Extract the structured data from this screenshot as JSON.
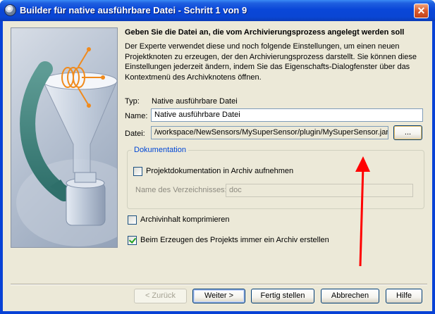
{
  "window": {
    "title": "Builder für native ausführbare Datei - Schritt 1 von 9",
    "close_label": "✕"
  },
  "content": {
    "heading": "Geben Sie die Datei an, die vom Archivierungsprozess angelegt werden soll",
    "description": "Der Experte verwendet diese und noch folgende Einstellungen, um einen neuen Projektknoten zu erzeugen, der den Archivierungsprozess darstellt. Sie können diese Einstellungen jederzeit ändern, indem Sie das Eigenschafts-Dialogfenster über das Kontextmenü des Archivknotens öffnen."
  },
  "form": {
    "type_label": "Typ:",
    "type_value": "Native ausführbare Datei",
    "name_label": "Name:",
    "name_value": "Native ausführbare Datei",
    "file_label": "Datei:",
    "file_value": "/workspace/NewSensors/MySuperSensor/plugin/MySuperSensor.jar",
    "browse_label": "..."
  },
  "documentation": {
    "legend": "Dokumentation",
    "include_docs_label": "Projektdokumentation in Archiv aufnehmen",
    "include_docs_checked": false,
    "dir_label": "Name des Verzeichnisses:",
    "dir_value": "doc"
  },
  "options": {
    "compress_label": "Archivinhalt komprimieren",
    "compress_checked": false,
    "always_build_label": "Beim Erzeugen des Projekts immer ein Archiv erstellen",
    "always_build_checked": true
  },
  "buttons": {
    "back": "< Zurück",
    "next": "Weiter >",
    "finish": "Fertig stellen",
    "cancel": "Abbrechen",
    "help": "Hilfe"
  },
  "colors": {
    "titlebar": "#0a47d8",
    "dialog_bg": "#ece9d8",
    "group_legend": "#0046d5",
    "annotation_arrow": "#ff0000"
  }
}
